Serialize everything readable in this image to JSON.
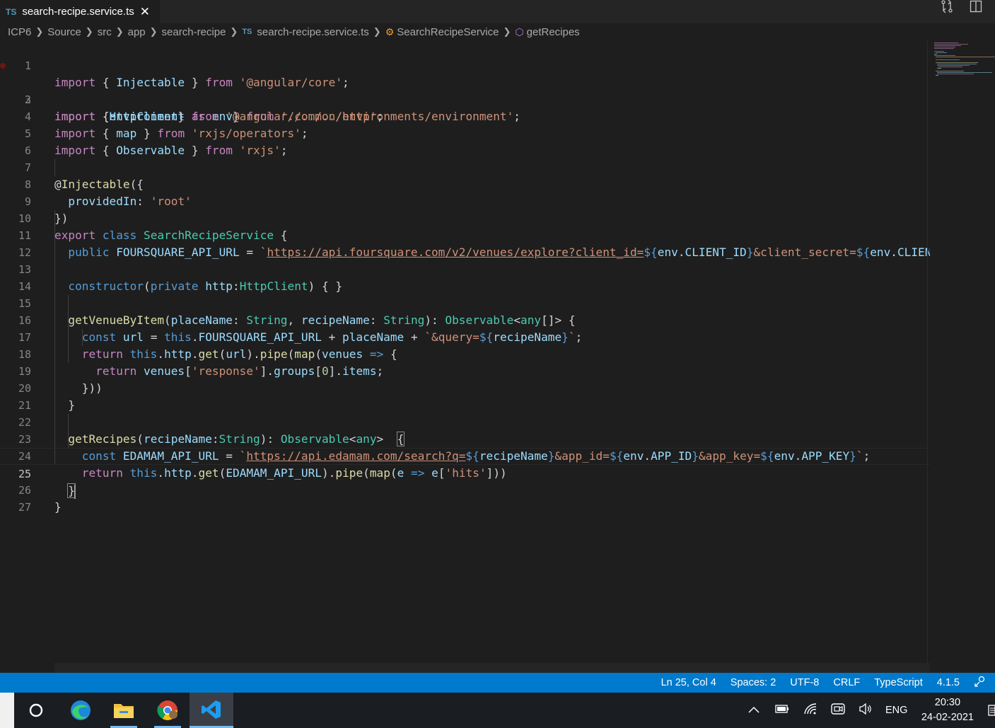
{
  "tab": {
    "type_badge": "TS",
    "filename": "search-recipe.service.ts",
    "close": "✕"
  },
  "breadcrumb": {
    "items": [
      "ICP6",
      "Source",
      "src",
      "app",
      "search-recipe"
    ],
    "file_badge": "TS",
    "file": "search-recipe.service.ts",
    "class_name": "SearchRecipeService",
    "method": "getRecipes"
  },
  "editor": {
    "line_numbers": [
      "1",
      "2",
      "3",
      "4",
      "5",
      "6",
      "7",
      "8",
      "9",
      "10",
      "11",
      "12",
      "13",
      "14",
      "15",
      "16",
      "17",
      "18",
      "19",
      "20",
      "21",
      "22",
      "23",
      "24",
      "25",
      "26",
      "27"
    ],
    "active_line": "25"
  },
  "status": {
    "position": "Ln 25, Col 4",
    "spaces": "Spaces: 2",
    "encoding": "UTF-8",
    "eol": "CRLF",
    "language": "TypeScript",
    "version": "4.1.5"
  },
  "taskbar": {
    "lang": "ENG",
    "time": "20:30",
    "date": "24-02-2021"
  },
  "colors": {
    "statusbar": "#007acc",
    "editor_bg": "#1e1e1e",
    "tab_bg": "#252526"
  }
}
